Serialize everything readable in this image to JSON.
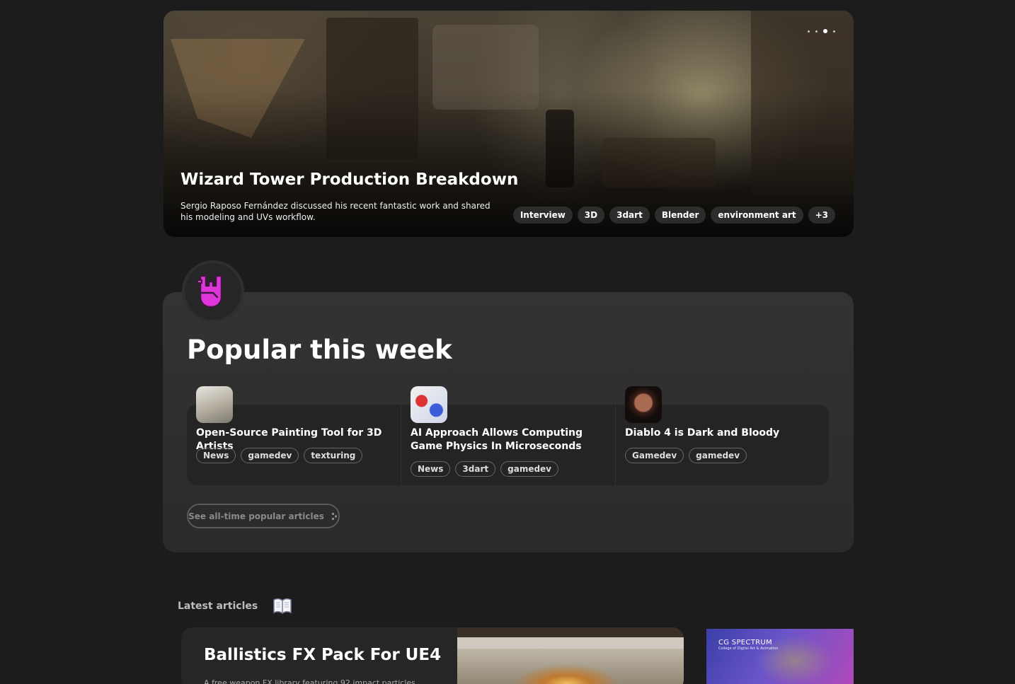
{
  "hero": {
    "title": "Wizard Tower Production Breakdown",
    "description": "Sergio Raposo Fernández discussed his recent fantastic work and shared his modeling and UVs workflow.",
    "tags": [
      "Interview",
      "3D",
      "3dart",
      "Blender",
      "environment art",
      "+3"
    ],
    "carousel_dots": 4,
    "active_dot": 2
  },
  "popular": {
    "badge_icon": "rock-hand-icon",
    "title": "Popular this week",
    "items": [
      {
        "title": "Open-Source Painting Tool for 3D Artists",
        "tags": [
          "News",
          "gamedev",
          "texturing"
        ]
      },
      {
        "title": "AI Approach Allows Computing Game Physics In Microseconds",
        "tags": [
          "News",
          "3dart",
          "gamedev"
        ]
      },
      {
        "title": "Diablo 4 is Dark and Bloody",
        "tags": [
          "Gamedev",
          "gamedev"
        ]
      }
    ],
    "see_all_label": "See all-time popular articles"
  },
  "latest": {
    "label": "Latest articles",
    "icon": "open-book-icon",
    "article": {
      "title": "Ballistics FX Pack For UE4",
      "description": "A free weapon FX library featuring 92 impact particles"
    },
    "ad": {
      "title": "CG SPECTRUM",
      "subtitle": "College of Digital Art & Animation"
    }
  },
  "colors": {
    "background": "#1c1c1c",
    "panel": "#303030",
    "accent": "#e035d9"
  }
}
